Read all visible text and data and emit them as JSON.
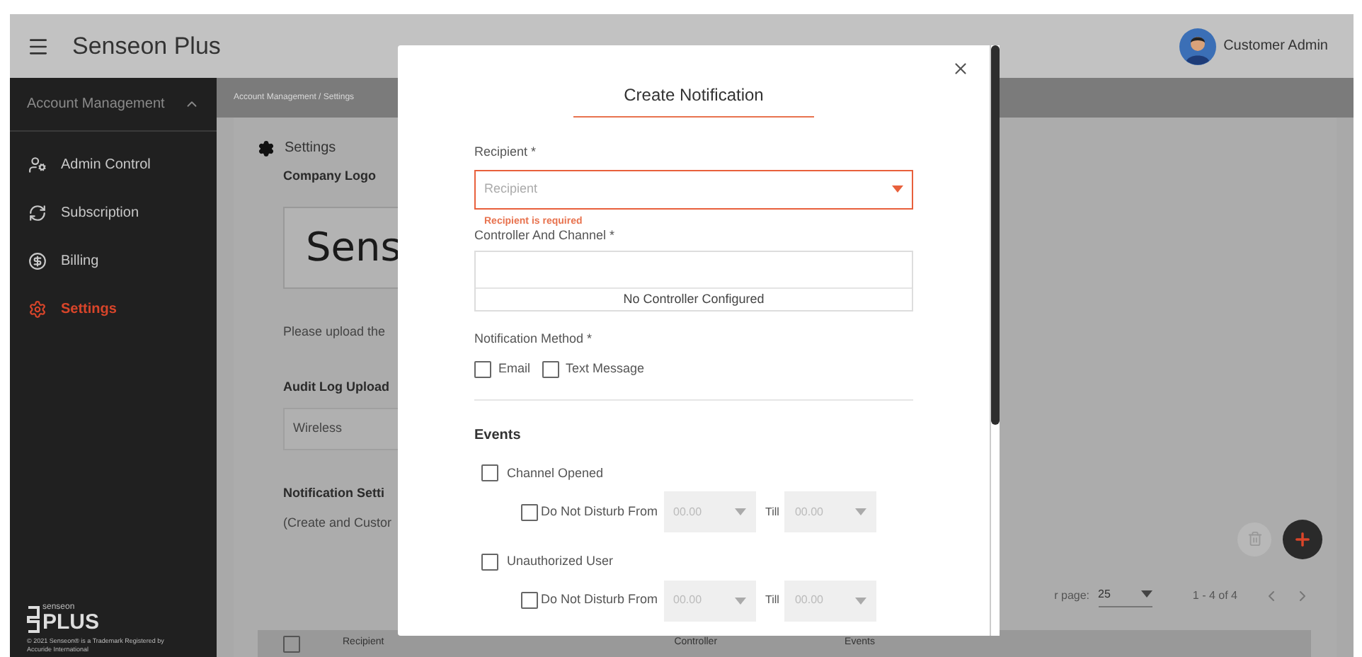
{
  "header": {
    "title": "Senseon Plus",
    "user_name": "Customer Admin"
  },
  "sidebar": {
    "section": {
      "label": "Account Management",
      "expanded": true
    },
    "items": [
      {
        "label": "Admin Control",
        "selected": false
      },
      {
        "label": "Subscription",
        "selected": false
      },
      {
        "label": "Billing",
        "selected": false
      },
      {
        "label": "Settings",
        "selected": true
      }
    ],
    "footer": {
      "brand_small": "senseon",
      "brand": "PLUS",
      "legal": "© 2021 Senseon® is a Trademark Registered by Accuride International"
    }
  },
  "breadcrumb": "Account Management / Settings",
  "settings": {
    "title": "Settings",
    "company_logo_label": "Company Logo",
    "logo_text": "Sens",
    "upload_hint": "Please upload the",
    "audit_label": "Audit Log Upload",
    "audit_value": "Wireless",
    "notification_label": "Notification Setti",
    "notification_hint": "(Create and Custor"
  },
  "pagination": {
    "rows_label": "r page:",
    "rows_value": "25",
    "range": "1 - 4 of 4"
  },
  "table": {
    "select_all_checked": false,
    "columns": [
      "Recipient",
      "Controller",
      "Events"
    ]
  },
  "modal": {
    "title": "Create Notification",
    "recipient_label": "Recipient *",
    "recipient_placeholder": "Recipient",
    "recipient_error": "Recipient is required",
    "controller_label": "Controller And Channel *",
    "controller_empty": "No Controller Configured",
    "method_label": "Notification Method *",
    "methods": [
      {
        "label": "Email",
        "checked": false
      },
      {
        "label": "Text Message",
        "checked": false
      }
    ],
    "events_title": "Events",
    "events": [
      {
        "label": "Channel Opened",
        "checked": false,
        "dnd": {
          "label": "Do Not Disturb From",
          "checked": false,
          "from": "00.00",
          "till_label": "Till",
          "till": "00.00"
        }
      },
      {
        "label": "Unauthorized User",
        "checked": false,
        "dnd": {
          "label": "Do Not Disturb From",
          "checked": false,
          "from": "00.00",
          "till_label": "Till",
          "till": "00.00"
        }
      }
    ]
  }
}
